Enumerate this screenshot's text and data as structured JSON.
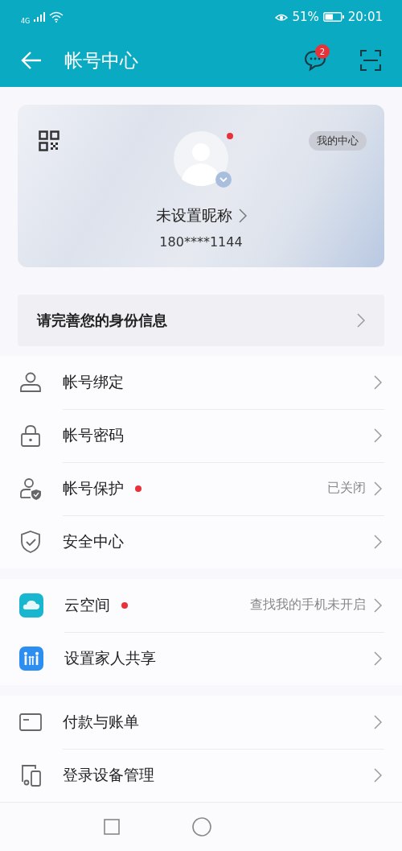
{
  "status_bar": {
    "network": "4G",
    "battery": "51%",
    "time": "20:01"
  },
  "header": {
    "title": "帐号中心",
    "message_count": "2"
  },
  "profile": {
    "badge": "我的中心",
    "nickname": "未设置昵称",
    "phone": "180****1144",
    "new_dot": true
  },
  "identity_prompt": "请完善您的身份信息",
  "groups": [
    {
      "items": [
        {
          "kind": "person",
          "label": "帐号绑定",
          "dot": false
        },
        {
          "kind": "lock",
          "label": "帐号密码",
          "dot": false
        },
        {
          "kind": "person-shield",
          "label": "帐号保护",
          "dot": true,
          "value": "已关闭"
        },
        {
          "kind": "shield",
          "label": "安全中心",
          "dot": false
        }
      ]
    },
    {
      "items": [
        {
          "kind": "cloud",
          "label": "云空间",
          "dot": true,
          "value": "查找我的手机未开启"
        },
        {
          "kind": "family",
          "label": "设置家人共享",
          "dot": false
        }
      ]
    },
    {
      "items": [
        {
          "kind": "card",
          "label": "付款与账单",
          "dot": false
        },
        {
          "kind": "devices",
          "label": "登录设备管理",
          "dot": false
        }
      ]
    }
  ]
}
